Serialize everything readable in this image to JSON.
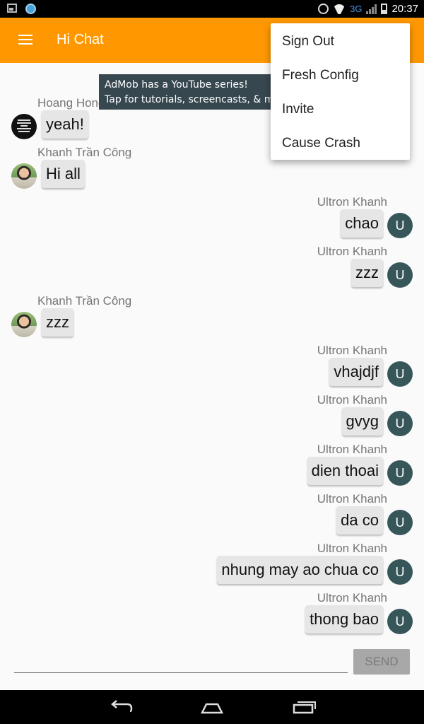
{
  "status_bar": {
    "network": "3G",
    "time": "20:37",
    "icons": [
      "image-icon",
      "app-notification-icon",
      "alarm-icon",
      "wifi-icon",
      "signal-icon",
      "battery-icon"
    ]
  },
  "app_bar": {
    "title": "Hi Chat",
    "background_color": "#ff9800",
    "menu_icon": "hamburger-icon"
  },
  "ad_banner": {
    "line1": "AdMob has a YouTube series!",
    "line2": "Tap for tutorials, screencasts, & more"
  },
  "overflow_menu": {
    "items": [
      {
        "label": "Sign Out"
      },
      {
        "label": "Fresh Config"
      },
      {
        "label": "Invite"
      },
      {
        "label": "Cause Crash"
      }
    ]
  },
  "messages": [
    {
      "sender": "Hoang Hong Khang",
      "text": "yeah!",
      "side": "left",
      "avatar": "keep-calm-image"
    },
    {
      "sender": "Khanh Trần Công",
      "text": "Hi all",
      "side": "left",
      "avatar": "user-photo"
    },
    {
      "sender": "Ultron Khanh",
      "text": "chao",
      "side": "right",
      "avatar_letter": "U"
    },
    {
      "sender": "Ultron Khanh",
      "text": "zzz",
      "side": "right",
      "avatar_letter": "U"
    },
    {
      "sender": "Khanh Trần Công",
      "text": "zzz",
      "side": "left",
      "avatar": "user-photo"
    },
    {
      "sender": "Ultron Khanh",
      "text": "vhajdjf",
      "side": "right",
      "avatar_letter": "U"
    },
    {
      "sender": "Ultron Khanh",
      "text": "gvyg",
      "side": "right",
      "avatar_letter": "U"
    },
    {
      "sender": "Ultron Khanh",
      "text": "dien thoai",
      "side": "right",
      "avatar_letter": "U"
    },
    {
      "sender": "Ultron Khanh",
      "text": "da co",
      "side": "right",
      "avatar_letter": "U"
    },
    {
      "sender": "Ultron Khanh",
      "text": "nhung may ao chua co",
      "side": "right",
      "avatar_letter": "U"
    },
    {
      "sender": "Ultron Khanh",
      "text": "thong bao",
      "side": "right",
      "avatar_letter": "U"
    }
  ],
  "compose": {
    "input_value": "",
    "send_label": "SEND"
  },
  "nav_bar": {
    "icons": [
      "back-icon",
      "home-icon",
      "recents-icon"
    ]
  }
}
